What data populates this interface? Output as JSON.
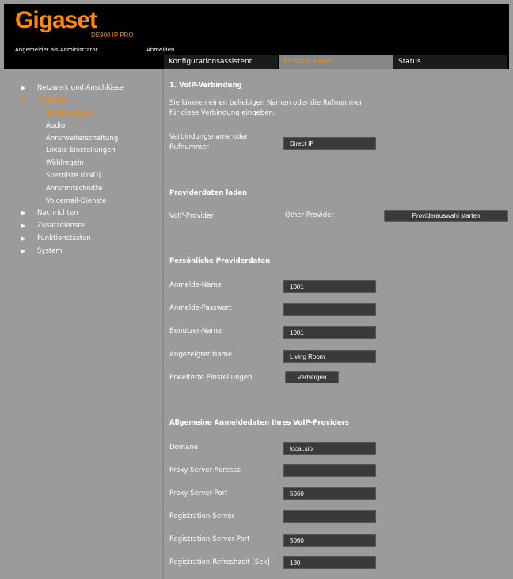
{
  "header": {
    "logo": "Gigaset",
    "model": "DE900 IP PRO",
    "login_info": "Angemeldet als Administrator",
    "logout": "Abmelden"
  },
  "tabs": [
    {
      "label": "Konfigurationsassistent",
      "active": false
    },
    {
      "label": "Einstellungen",
      "active": true
    },
    {
      "label": "Status",
      "active": false
    }
  ],
  "sidebar": {
    "items": [
      {
        "label": "Netzwerk und Anschlüsse"
      },
      {
        "label": "Telefonie"
      },
      {
        "label": "Nachrichten"
      },
      {
        "label": "Zusatzdienste"
      },
      {
        "label": "Funktionstasten"
      },
      {
        "label": "System"
      }
    ],
    "subitems": [
      {
        "label": "Verbindungen"
      },
      {
        "label": "Audio"
      },
      {
        "label": "Anrufweiterschaltung"
      },
      {
        "label": "Lokale Einstellungen"
      },
      {
        "label": "Wählregeln"
      },
      {
        "label": "Sperrliste (DND)"
      },
      {
        "label": "Anrufmitschnitte"
      },
      {
        "label": "Voicemail-Dienste"
      }
    ]
  },
  "main": {
    "section1": {
      "title": "1. VoIP-Verbindung",
      "desc_line1": "Sie können einen beliebigen Namen oder die Rufnummer",
      "desc_line2": "für diese Verbindung eingeben.",
      "conn_label_line1": "Verbindungsname oder",
      "conn_label_line2": "Rufnummer",
      "conn_value": "Direct IP"
    },
    "provider": {
      "title": "Providerdaten laden",
      "voip_label": "VoIP-Provider",
      "voip_value": "Other Provider",
      "start_button": "Providerauswahl starten"
    },
    "personal": {
      "title": "Persönliche Providerdaten",
      "login_name_label": "Anmelde-Name",
      "login_name_value": "1001",
      "login_pw_label": "Anmelde-Passwort",
      "login_pw_value": "",
      "user_name_label": "Benutzer-Name",
      "user_name_value": "1001",
      "display_name_label": "Angezeigter Name",
      "display_name_value": "Living Room",
      "advanced_label": "Erweiterte Einstellungen",
      "hide_button": "Verbergen"
    },
    "general": {
      "title": "Allgemeine Anmeldedaten Ihres VoIP-Providers",
      "domain_label": "Domäne",
      "domain_value": "local.sip",
      "proxy_addr_label": "Proxy-Server-Adresse",
      "proxy_addr_value": "",
      "proxy_port_label": "Proxy-Server-Port",
      "proxy_port_value": "5060",
      "reg_server_label": "Registration-Server",
      "reg_server_value": "",
      "reg_port_label": "Registration-Server-Port",
      "reg_port_value": "5060",
      "reg_refresh_label": "Registration-Refreshzeit [Sek]",
      "reg_refresh_value": "180"
    }
  },
  "colors": {
    "accent": "#ff8a00",
    "background": "#9b9b9b",
    "header": "#000000",
    "input": "#3a3a3a"
  }
}
